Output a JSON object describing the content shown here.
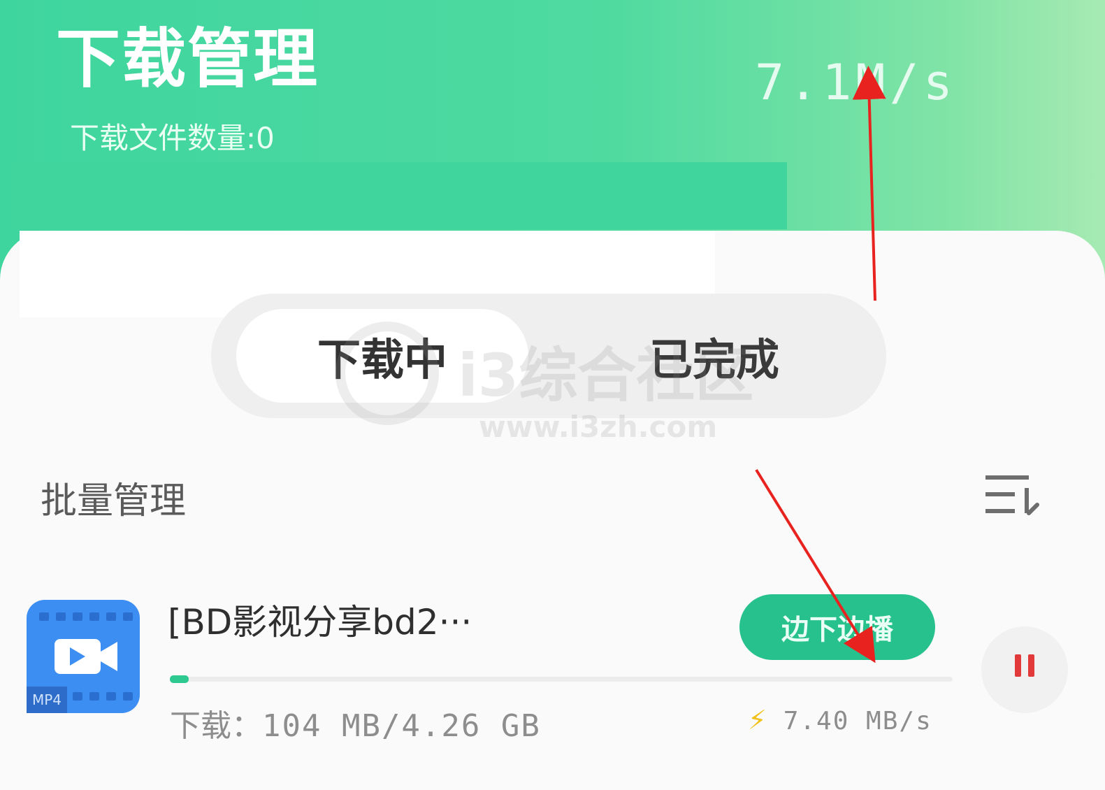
{
  "header": {
    "title": "下载管理",
    "file_count": "下载文件数量:0",
    "total_speed": "7.1M/s"
  },
  "tabs": [
    {
      "label": "下载中",
      "active": true
    },
    {
      "label": "已完成",
      "active": false
    }
  ],
  "watermark": {
    "text": "i3综合社区",
    "url": "www.i3zh.com"
  },
  "list": {
    "batch_label": "批量管理",
    "sort_icon": "sort-icon"
  },
  "items": [
    {
      "name": "[BD影视分享bd2···",
      "file_type": "MP4",
      "action_label": "边下边播",
      "progress_percent": 2.4,
      "download_label": "下载：",
      "downloaded": "104 MB/4.26 GB",
      "speed": "7.40 MB/s",
      "icon": "video-file-icon",
      "control_icon": "pause-icon"
    }
  ],
  "colors": {
    "header_green": "#3fd59f",
    "button_green": "#27c18d",
    "pause_red": "#e23a3a",
    "bolt_yellow": "#f1c21b",
    "annotation_red": "#e8231f"
  }
}
